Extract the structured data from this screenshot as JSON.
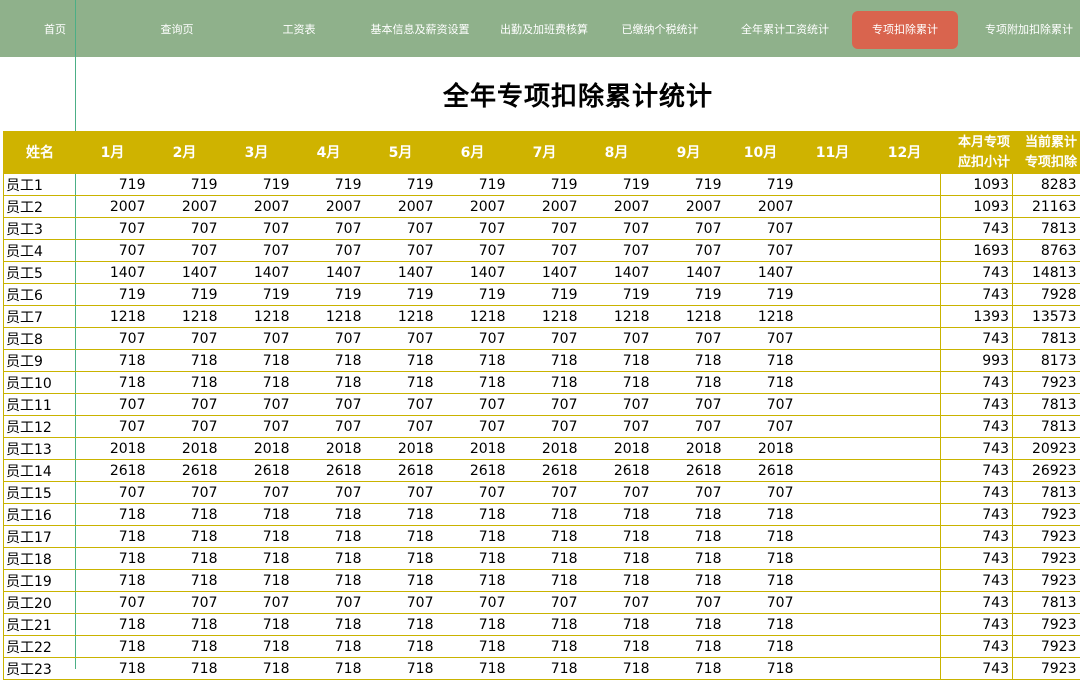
{
  "nav": {
    "items": [
      {
        "label": "首页",
        "active": false
      },
      {
        "label": "查询页",
        "active": false
      },
      {
        "label": "工资表",
        "active": false
      },
      {
        "label": "基本信息及薪资设置",
        "active": false
      },
      {
        "label": "出勤及加班费核算",
        "active": false
      },
      {
        "label": "已缴纳个税统计",
        "active": false
      },
      {
        "label": "全年累计工资统计",
        "active": false
      },
      {
        "label": "专项扣除累计",
        "active": true
      },
      {
        "label": "专项附加扣除累计",
        "active": false
      }
    ]
  },
  "title": "全年专项扣除累计统计",
  "table": {
    "headers": {
      "name": "姓名",
      "months": [
        "1月",
        "2月",
        "3月",
        "4月",
        "5月",
        "6月",
        "7月",
        "8月",
        "9月",
        "10月",
        "11月",
        "12月"
      ],
      "current_line1": "本月专项",
      "current_line2": "应扣小计",
      "total_line1": "当前累计",
      "total_line2": "专项扣除"
    },
    "rows": [
      {
        "name": "员工1",
        "m": [
          719,
          719,
          719,
          719,
          719,
          719,
          719,
          719,
          719,
          719,
          "",
          ""
        ],
        "current": 1093,
        "total": 8283
      },
      {
        "name": "员工2",
        "m": [
          2007,
          2007,
          2007,
          2007,
          2007,
          2007,
          2007,
          2007,
          2007,
          2007,
          "",
          ""
        ],
        "current": 1093,
        "total": 21163
      },
      {
        "name": "员工3",
        "m": [
          707,
          707,
          707,
          707,
          707,
          707,
          707,
          707,
          707,
          707,
          "",
          ""
        ],
        "current": 743,
        "total": 7813
      },
      {
        "name": "员工4",
        "m": [
          707,
          707,
          707,
          707,
          707,
          707,
          707,
          707,
          707,
          707,
          "",
          ""
        ],
        "current": 1693,
        "total": 8763
      },
      {
        "name": "员工5",
        "m": [
          1407,
          1407,
          1407,
          1407,
          1407,
          1407,
          1407,
          1407,
          1407,
          1407,
          "",
          ""
        ],
        "current": 743,
        "total": 14813
      },
      {
        "name": "员工6",
        "m": [
          719,
          719,
          719,
          719,
          719,
          719,
          719,
          719,
          719,
          719,
          "",
          ""
        ],
        "current": 743,
        "total": 7928
      },
      {
        "name": "员工7",
        "m": [
          1218,
          1218,
          1218,
          1218,
          1218,
          1218,
          1218,
          1218,
          1218,
          1218,
          "",
          ""
        ],
        "current": 1393,
        "total": 13573
      },
      {
        "name": "员工8",
        "m": [
          707,
          707,
          707,
          707,
          707,
          707,
          707,
          707,
          707,
          707,
          "",
          ""
        ],
        "current": 743,
        "total": 7813
      },
      {
        "name": "员工9",
        "m": [
          718,
          718,
          718,
          718,
          718,
          718,
          718,
          718,
          718,
          718,
          "",
          ""
        ],
        "current": 993,
        "total": 8173
      },
      {
        "name": "员工10",
        "m": [
          718,
          718,
          718,
          718,
          718,
          718,
          718,
          718,
          718,
          718,
          "",
          ""
        ],
        "current": 743,
        "total": 7923
      },
      {
        "name": "员工11",
        "m": [
          707,
          707,
          707,
          707,
          707,
          707,
          707,
          707,
          707,
          707,
          "",
          ""
        ],
        "current": 743,
        "total": 7813
      },
      {
        "name": "员工12",
        "m": [
          707,
          707,
          707,
          707,
          707,
          707,
          707,
          707,
          707,
          707,
          "",
          ""
        ],
        "current": 743,
        "total": 7813
      },
      {
        "name": "员工13",
        "m": [
          2018,
          2018,
          2018,
          2018,
          2018,
          2018,
          2018,
          2018,
          2018,
          2018,
          "",
          ""
        ],
        "current": 743,
        "total": 20923
      },
      {
        "name": "员工14",
        "m": [
          2618,
          2618,
          2618,
          2618,
          2618,
          2618,
          2618,
          2618,
          2618,
          2618,
          "",
          ""
        ],
        "current": 743,
        "total": 26923
      },
      {
        "name": "员工15",
        "m": [
          707,
          707,
          707,
          707,
          707,
          707,
          707,
          707,
          707,
          707,
          "",
          ""
        ],
        "current": 743,
        "total": 7813
      },
      {
        "name": "员工16",
        "m": [
          718,
          718,
          718,
          718,
          718,
          718,
          718,
          718,
          718,
          718,
          "",
          ""
        ],
        "current": 743,
        "total": 7923
      },
      {
        "name": "员工17",
        "m": [
          718,
          718,
          718,
          718,
          718,
          718,
          718,
          718,
          718,
          718,
          "",
          ""
        ],
        "current": 743,
        "total": 7923
      },
      {
        "name": "员工18",
        "m": [
          718,
          718,
          718,
          718,
          718,
          718,
          718,
          718,
          718,
          718,
          "",
          ""
        ],
        "current": 743,
        "total": 7923
      },
      {
        "name": "员工19",
        "m": [
          718,
          718,
          718,
          718,
          718,
          718,
          718,
          718,
          718,
          718,
          "",
          ""
        ],
        "current": 743,
        "total": 7923
      },
      {
        "name": "员工20",
        "m": [
          707,
          707,
          707,
          707,
          707,
          707,
          707,
          707,
          707,
          707,
          "",
          ""
        ],
        "current": 743,
        "total": 7813
      },
      {
        "name": "员工21",
        "m": [
          718,
          718,
          718,
          718,
          718,
          718,
          718,
          718,
          718,
          718,
          "",
          ""
        ],
        "current": 743,
        "total": 7923
      },
      {
        "name": "员工22",
        "m": [
          718,
          718,
          718,
          718,
          718,
          718,
          718,
          718,
          718,
          718,
          "",
          ""
        ],
        "current": 743,
        "total": 7923
      },
      {
        "name": "员工23",
        "m": [
          718,
          718,
          718,
          718,
          718,
          718,
          718,
          718,
          718,
          718,
          "",
          ""
        ],
        "current": 743,
        "total": 7923
      }
    ]
  },
  "colors": {
    "nav_bg": "#8fb18b",
    "nav_active": "#d9644e",
    "header_bg": "#cfb300",
    "grid_accent": "#4caf86"
  }
}
